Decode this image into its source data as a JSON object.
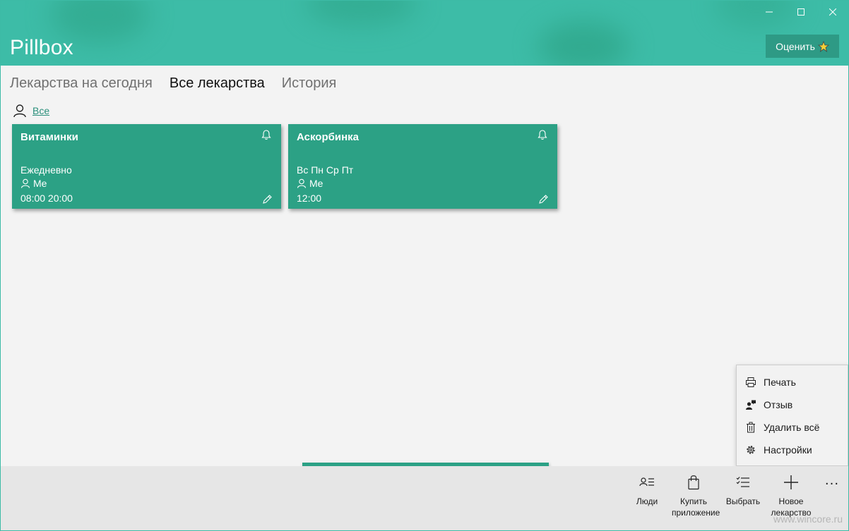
{
  "window": {
    "title": "Pillbox",
    "rate_label": "Оценить"
  },
  "tabs": [
    {
      "label": "Лекарства на сегодня",
      "active": false
    },
    {
      "label": "Все лекарства",
      "active": true
    },
    {
      "label": "История",
      "active": false
    }
  ],
  "filter": {
    "label": "Все",
    "icon": "person-icon"
  },
  "cards": [
    {
      "title": "Витаминки",
      "schedule": "Ежедневно",
      "person": "Me",
      "times": "08:00 20:00"
    },
    {
      "title": "Аскорбинка",
      "schedule": "Вс Пн Ср Пт",
      "person": "Me",
      "times": "12:00"
    }
  ],
  "commandbar": {
    "people": "Люди",
    "buy_app": "Купить приложение",
    "select": "Выбрать",
    "new_med": "Новое лекарство",
    "more": "···"
  },
  "menu": {
    "print": "Печать",
    "feedback": "Отзыв",
    "delete_all": "Удалить всё",
    "settings": "Настройки"
  },
  "watermark": "www.wincore.ru",
  "colors": {
    "accent": "#3dbca7",
    "card": "#2ca185",
    "link": "#2a8f7b"
  }
}
